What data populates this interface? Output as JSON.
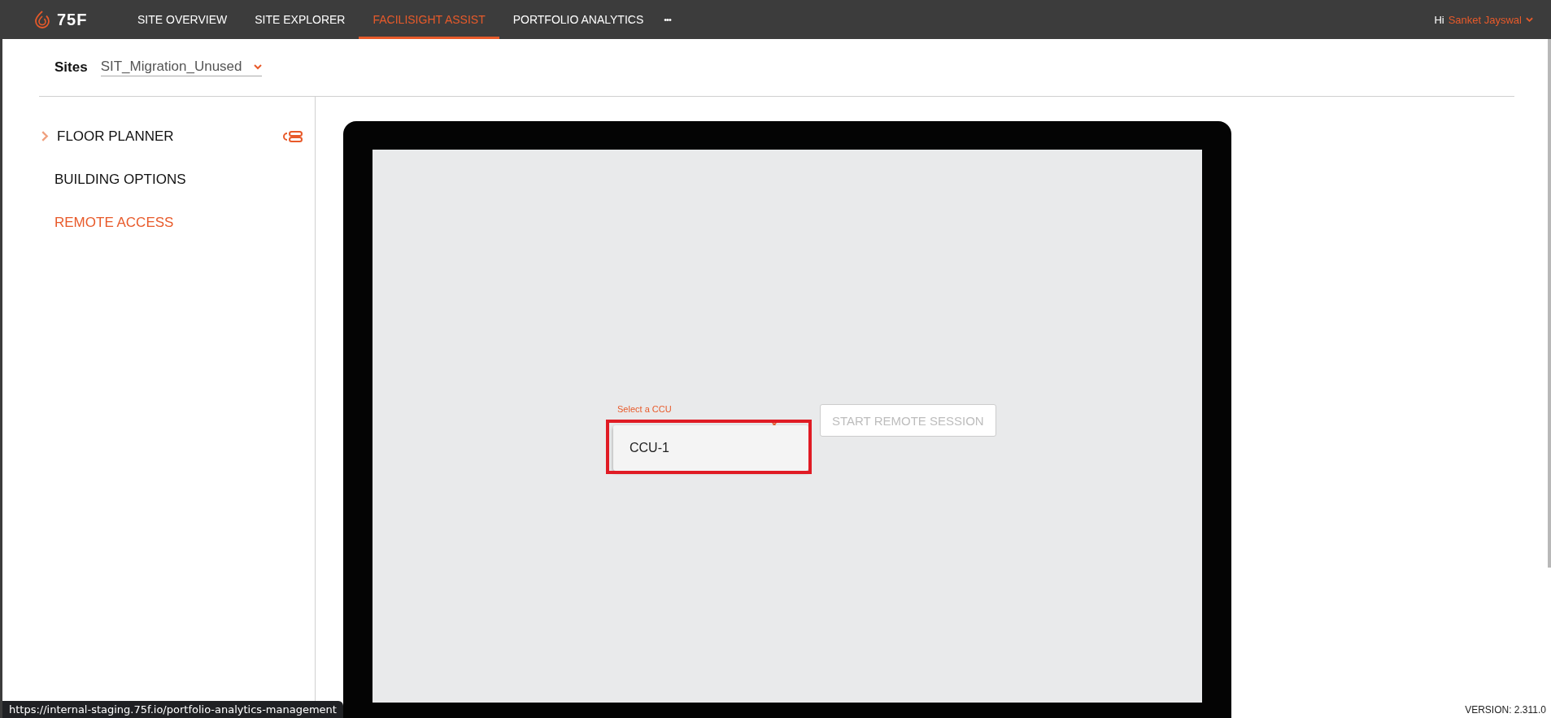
{
  "topbar": {
    "logo": "75F",
    "nav": [
      {
        "label": "SITE OVERVIEW",
        "selected": false
      },
      {
        "label": "SITE EXPLORER",
        "selected": false
      },
      {
        "label": "FACILISIGHT ASSIST",
        "selected": true
      },
      {
        "label": "PORTFOLIO ANALYTICS",
        "selected": false
      }
    ],
    "more": "•••",
    "greeting": "Hi",
    "user": "Sanket Jayswal"
  },
  "sites": {
    "label": "Sites",
    "value": "SIT_Migration_Unused"
  },
  "sidebar": {
    "items": [
      {
        "label": "FLOOR PLANNER",
        "kind": "expandable",
        "selected": false
      },
      {
        "label": "BUILDING OPTIONS",
        "kind": "plain",
        "selected": false
      },
      {
        "label": "REMOTE ACCESS",
        "kind": "plain",
        "selected": true
      }
    ]
  },
  "remote": {
    "field_label": "Select a CCU",
    "highlighted": true,
    "options": [
      {
        "label": "CCU-1",
        "selected": false
      }
    ],
    "button": {
      "label": "START REMOTE SESSION",
      "disabled": true
    }
  },
  "status_url": "https://internal-staging.75f.io/portfolio-analytics-management",
  "version": "VERSION: 2.311.0"
}
